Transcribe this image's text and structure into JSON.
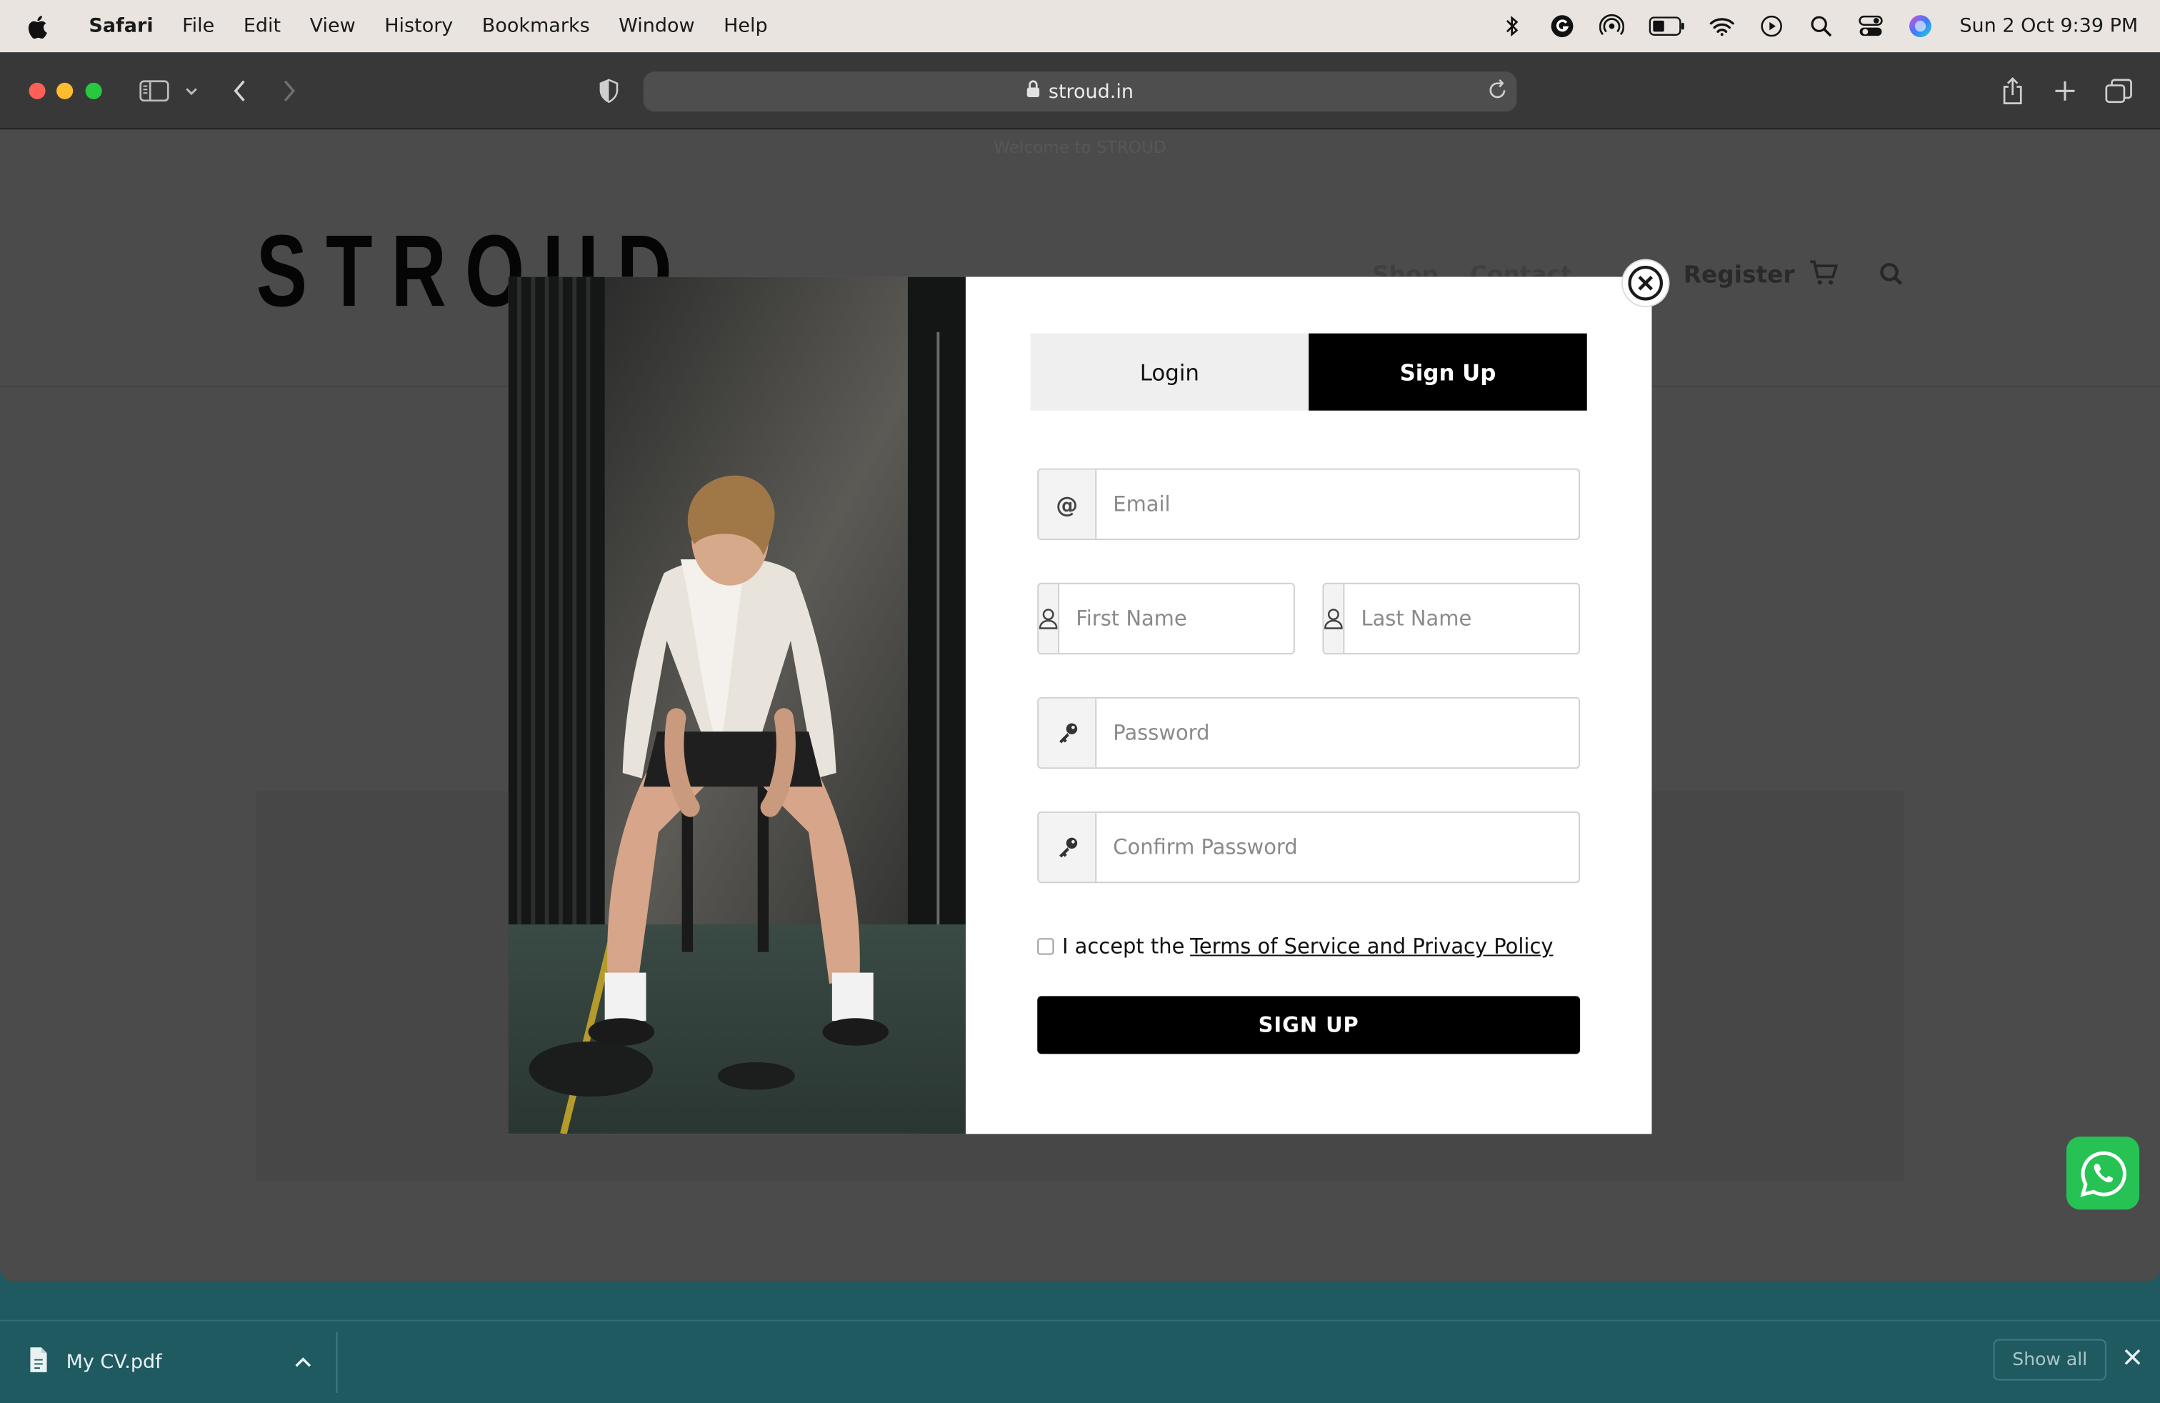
{
  "menubar": {
    "app_name": "Safari",
    "menus": [
      "File",
      "Edit",
      "View",
      "History",
      "Bookmarks",
      "Window",
      "Help"
    ],
    "clock": "Sun 2 Oct  9:39 PM"
  },
  "browser": {
    "url": "stroud.in"
  },
  "site": {
    "welcome": "Welcome to STROUD",
    "logo": "STROUD",
    "nav_ghost": [
      "Shop",
      "Contact"
    ],
    "nav_register": "Register"
  },
  "modal": {
    "tabs": {
      "login": "Login",
      "signup": "Sign Up"
    },
    "fields": {
      "email": {
        "placeholder": "Email",
        "icon": "@"
      },
      "first_name": {
        "placeholder": "First Name"
      },
      "last_name": {
        "placeholder": "Last Name"
      },
      "password": {
        "placeholder": "Password"
      },
      "confirm_password": {
        "placeholder": "Confirm Password"
      }
    },
    "terms": {
      "prefix": "I accept the",
      "link": "Terms of Service and Privacy Policy"
    },
    "submit_label": "SIGN UP"
  },
  "downloads": {
    "file_name": "My CV.pdf",
    "show_all": "Show all"
  },
  "colors": {
    "whatsapp": "#26c253",
    "downloads_bar": "#1f5a60",
    "primary_button": "#000000"
  }
}
